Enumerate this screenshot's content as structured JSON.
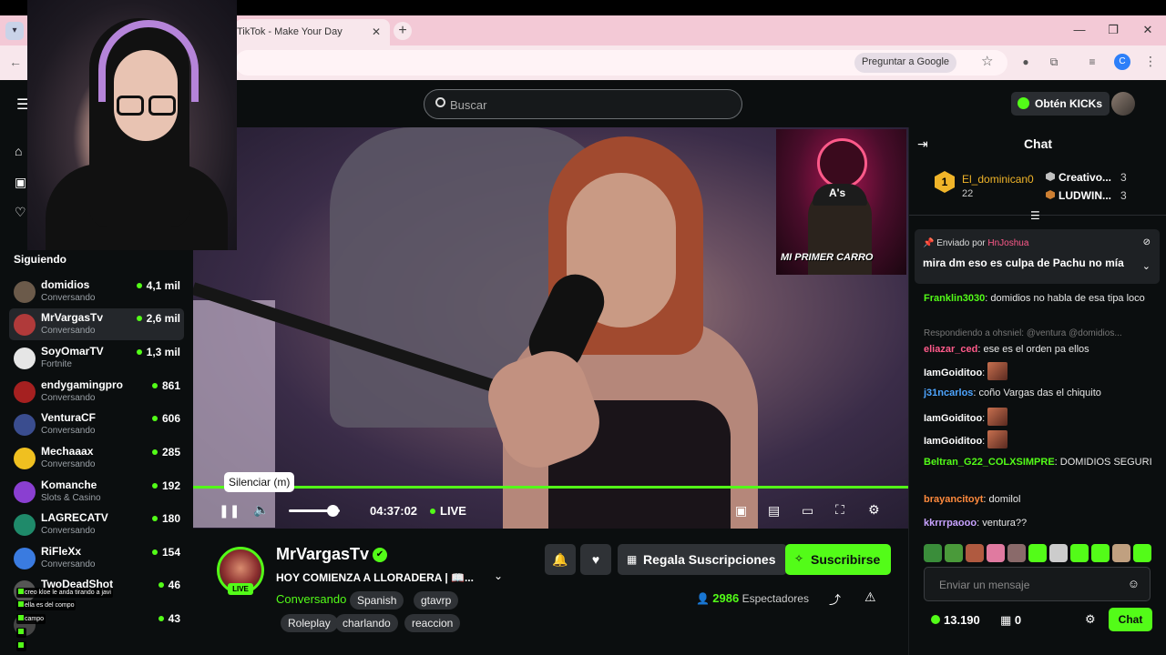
{
  "browser": {
    "tab_title": "TikTok - Make Your Day",
    "tab_close": "✕",
    "new_tab": "+",
    "pregunta": "Preguntar a Google",
    "profile_initial": "C",
    "minimize": "—",
    "restore": "❐",
    "close": "✕"
  },
  "header": {
    "search_placeholder": "Buscar",
    "kicks_label": "Obtén KICKs"
  },
  "sidebar": {
    "following_title": "Siguiendo",
    "items": [
      {
        "name": "domidios",
        "category": "Conversando",
        "viewers": "4,1 mil",
        "avatar_color": "#6b5a4a"
      },
      {
        "name": "MrVargasTv",
        "category": "Conversando",
        "viewers": "2,6 mil",
        "avatar_color": "#b03a3a"
      },
      {
        "name": "SoyOmarTV",
        "category": "Fortnite",
        "viewers": "1,3 mil",
        "avatar_color": "#e6e6e6"
      },
      {
        "name": "endygamingpro",
        "category": "Conversando",
        "viewers": "861",
        "avatar_color": "#a52020"
      },
      {
        "name": "VenturaCF",
        "category": "Conversando",
        "viewers": "606",
        "avatar_color": "#3a4d8f"
      },
      {
        "name": "Mechaaax",
        "category": "Conversando",
        "viewers": "285",
        "avatar_color": "#f0c020"
      },
      {
        "name": "Komanche",
        "category": "Slots & Casino",
        "viewers": "192",
        "avatar_color": "#8a3fd1"
      },
      {
        "name": "LAGRECATV",
        "category": "Conversando",
        "viewers": "180",
        "avatar_color": "#1f8a6a"
      },
      {
        "name": "RiFleXx",
        "category": "Conversando",
        "viewers": "154",
        "avatar_color": "#3a7be0"
      },
      {
        "name": "TwoDeadShot",
        "category": "",
        "viewers": "46",
        "avatar_color": "#555555"
      },
      {
        "name": "",
        "category": "",
        "viewers": "43",
        "avatar_color": "#444444"
      }
    ]
  },
  "overlay_chat": [
    "creo kloe le anda tirando a javi",
    "ella es del compo",
    "campo",
    "",
    ""
  ],
  "player": {
    "tooltip": "Silenciar (m)",
    "timecode": "04:37:02",
    "live_label": "LIVE",
    "pip_caption": "MI PRIMER CARRO",
    "pip_cap_text": "A's",
    "volume_level": 0.85
  },
  "stream": {
    "streamer": "MrVargasTv",
    "live_badge": "LIVE",
    "title": "HOY COMIENZA A LLORADERA | 📖...",
    "category": "Conversando",
    "tags": [
      "Spanish",
      "gtavrp",
      "Roleplay",
      "charlando",
      "reaccion"
    ],
    "gift_button": "Regala Suscripciones",
    "subscribe_button": "Suscribirse",
    "viewers_number": "2986",
    "viewers_label": "Espectadores"
  },
  "chat": {
    "title": "Chat",
    "leaderboard": {
      "first": {
        "rank": "1",
        "name": "El_dominican0",
        "count": "22"
      },
      "others": [
        {
          "name": "Creativo...",
          "count": "3",
          "color": "#c0c0c0"
        },
        {
          "name": "LUDWIN...",
          "count": "3",
          "color": "#cd7f32"
        }
      ]
    },
    "pinned": {
      "by_label": "Enviado por",
      "user": "HnJoshua",
      "message": "mira dm eso es culpa de Pachu no mía"
    },
    "messages": [
      {
        "user": "Franklin3030",
        "color": "#53fc18",
        "text": "domidios no habla de esa tipa loco"
      },
      {
        "reply": "Respondiendo a ohsniel: @ventura @domidios..."
      },
      {
        "user": "eliazar_ced",
        "color": "#ff5a8a",
        "text": "ese es el orden pa ellos"
      },
      {
        "user": "IamGoiditoo",
        "color": "#ffffff",
        "text": ""
      },
      {
        "user": "j31ncarlos",
        "color": "#4ea5ff",
        "text": "coño Vargas das el chiquito"
      },
      {
        "user": "IamGoiditoo",
        "color": "#ffffff",
        "text": ""
      },
      {
        "user": "IamGoiditoo",
        "color": "#ffffff",
        "text": ""
      },
      {
        "user": "Beltran_G22_COLXSIMPRE",
        "color": "#53fc18",
        "text": "DOMIDIOS SEGURI"
      },
      {
        "user": "brayancitoyt",
        "color": "#ff8a3d",
        "text": "domilol"
      },
      {
        "user": "kkrrrpaooo",
        "color": "#c8a2ff",
        "text": "ventura??"
      }
    ],
    "input_placeholder": "Enviar un mensaje",
    "points": "13.190",
    "gift_count": "0",
    "send_label": "Chat"
  }
}
